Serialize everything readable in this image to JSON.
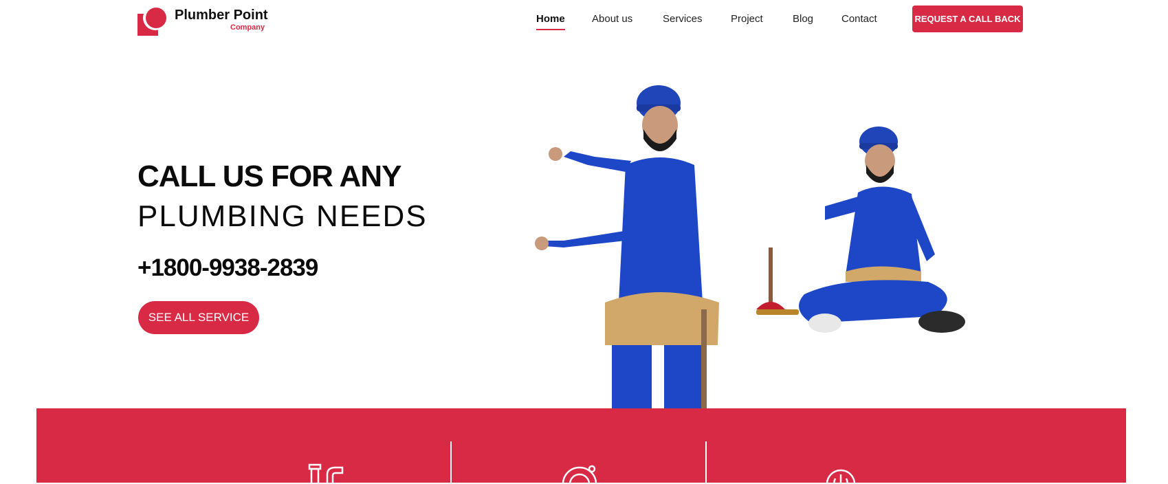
{
  "brand": {
    "name": "Plumber Point",
    "sub": "Company",
    "accent": "#d92a45"
  },
  "nav": {
    "items": [
      {
        "label": "Home",
        "active": true
      },
      {
        "label": "About us",
        "active": false
      },
      {
        "label": "Services",
        "active": false
      },
      {
        "label": "Project",
        "active": false
      },
      {
        "label": "Blog",
        "active": false
      },
      {
        "label": "Contact",
        "active": false
      }
    ],
    "cta_label": "REQUEST A CALL BACK"
  },
  "hero": {
    "title_line1": "CALL US FOR ANY",
    "title_line2": "PLUMBING NEEDS",
    "phone": "+1800-9938-2839",
    "button_label": "SEE ALL SERVICE"
  },
  "services_band": {
    "icons": [
      "pipe-fittings-icon",
      "gear-settings-icon",
      "power-gear-icon"
    ]
  }
}
